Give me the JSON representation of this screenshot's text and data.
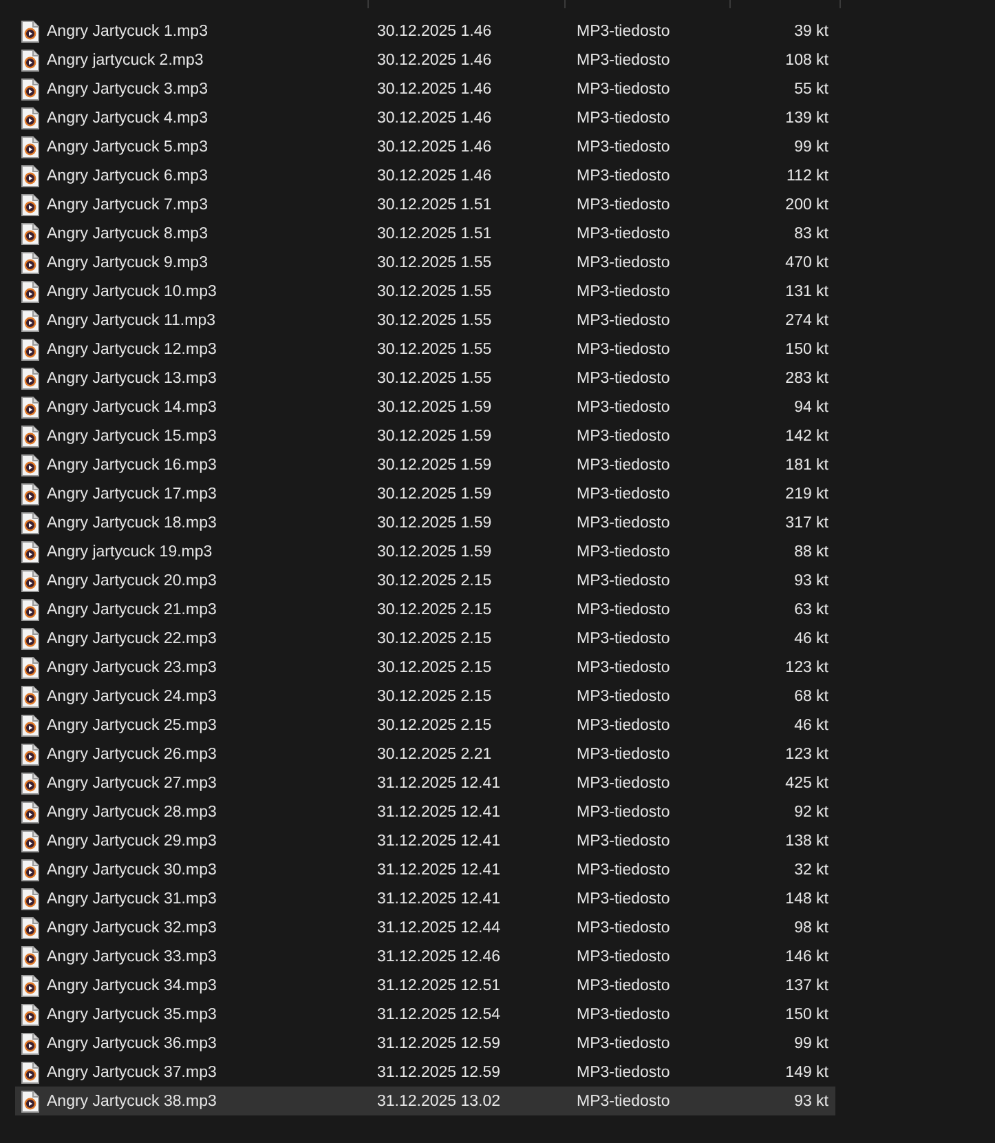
{
  "files": [
    {
      "name": "Angry Jartycuck 1.mp3",
      "date": "30.12.2025 1.46",
      "type": "MP3-tiedosto",
      "size": "39 kt",
      "selected": false
    },
    {
      "name": "Angry jartycuck 2.mp3",
      "date": "30.12.2025 1.46",
      "type": "MP3-tiedosto",
      "size": "108 kt",
      "selected": false
    },
    {
      "name": "Angry Jartycuck 3.mp3",
      "date": "30.12.2025 1.46",
      "type": "MP3-tiedosto",
      "size": "55 kt",
      "selected": false
    },
    {
      "name": "Angry Jartycuck 4.mp3",
      "date": "30.12.2025 1.46",
      "type": "MP3-tiedosto",
      "size": "139 kt",
      "selected": false
    },
    {
      "name": "Angry Jartycuck 5.mp3",
      "date": "30.12.2025 1.46",
      "type": "MP3-tiedosto",
      "size": "99 kt",
      "selected": false
    },
    {
      "name": "Angry Jartycuck 6.mp3",
      "date": "30.12.2025 1.46",
      "type": "MP3-tiedosto",
      "size": "112 kt",
      "selected": false
    },
    {
      "name": "Angry Jartycuck 7.mp3",
      "date": "30.12.2025 1.51",
      "type": "MP3-tiedosto",
      "size": "200 kt",
      "selected": false
    },
    {
      "name": "Angry Jartycuck 8.mp3",
      "date": "30.12.2025 1.51",
      "type": "MP3-tiedosto",
      "size": "83 kt",
      "selected": false
    },
    {
      "name": "Angry Jartycuck 9.mp3",
      "date": "30.12.2025 1.55",
      "type": "MP3-tiedosto",
      "size": "470 kt",
      "selected": false
    },
    {
      "name": "Angry Jartycuck 10.mp3",
      "date": "30.12.2025 1.55",
      "type": "MP3-tiedosto",
      "size": "131 kt",
      "selected": false
    },
    {
      "name": "Angry Jartycuck 11.mp3",
      "date": "30.12.2025 1.55",
      "type": "MP3-tiedosto",
      "size": "274 kt",
      "selected": false
    },
    {
      "name": "Angry Jartycuck 12.mp3",
      "date": "30.12.2025 1.55",
      "type": "MP3-tiedosto",
      "size": "150 kt",
      "selected": false
    },
    {
      "name": "Angry Jartycuck 13.mp3",
      "date": "30.12.2025 1.55",
      "type": "MP3-tiedosto",
      "size": "283 kt",
      "selected": false
    },
    {
      "name": "Angry Jartycuck 14.mp3",
      "date": "30.12.2025 1.59",
      "type": "MP3-tiedosto",
      "size": "94 kt",
      "selected": false
    },
    {
      "name": "Angry Jartycuck 15.mp3",
      "date": "30.12.2025 1.59",
      "type": "MP3-tiedosto",
      "size": "142 kt",
      "selected": false
    },
    {
      "name": "Angry Jartycuck 16.mp3",
      "date": "30.12.2025 1.59",
      "type": "MP3-tiedosto",
      "size": "181 kt",
      "selected": false
    },
    {
      "name": "Angry Jartycuck 17.mp3",
      "date": "30.12.2025 1.59",
      "type": "MP3-tiedosto",
      "size": "219 kt",
      "selected": false
    },
    {
      "name": "Angry Jartycuck 18.mp3",
      "date": "30.12.2025 1.59",
      "type": "MP3-tiedosto",
      "size": "317 kt",
      "selected": false
    },
    {
      "name": "Angry jartycuck 19.mp3",
      "date": "30.12.2025 1.59",
      "type": "MP3-tiedosto",
      "size": "88 kt",
      "selected": false
    },
    {
      "name": "Angry Jartycuck 20.mp3",
      "date": "30.12.2025 2.15",
      "type": "MP3-tiedosto",
      "size": "93 kt",
      "selected": false
    },
    {
      "name": "Angry Jartycuck 21.mp3",
      "date": "30.12.2025 2.15",
      "type": "MP3-tiedosto",
      "size": "63 kt",
      "selected": false
    },
    {
      "name": "Angry Jartycuck 22.mp3",
      "date": "30.12.2025 2.15",
      "type": "MP3-tiedosto",
      "size": "46 kt",
      "selected": false
    },
    {
      "name": "Angry Jartycuck 23.mp3",
      "date": "30.12.2025 2.15",
      "type": "MP3-tiedosto",
      "size": "123 kt",
      "selected": false
    },
    {
      "name": "Angry Jartycuck 24.mp3",
      "date": "30.12.2025 2.15",
      "type": "MP3-tiedosto",
      "size": "68 kt",
      "selected": false
    },
    {
      "name": "Angry Jartycuck 25.mp3",
      "date": "30.12.2025 2.15",
      "type": "MP3-tiedosto",
      "size": "46 kt",
      "selected": false
    },
    {
      "name": "Angry Jartycuck 26.mp3",
      "date": "30.12.2025 2.21",
      "type": "MP3-tiedosto",
      "size": "123 kt",
      "selected": false
    },
    {
      "name": "Angry Jartycuck 27.mp3",
      "date": "31.12.2025 12.41",
      "type": "MP3-tiedosto",
      "size": "425 kt",
      "selected": false
    },
    {
      "name": "Angry Jartycuck 28.mp3",
      "date": "31.12.2025 12.41",
      "type": "MP3-tiedosto",
      "size": "92 kt",
      "selected": false
    },
    {
      "name": "Angry Jartycuck 29.mp3",
      "date": "31.12.2025 12.41",
      "type": "MP3-tiedosto",
      "size": "138 kt",
      "selected": false
    },
    {
      "name": "Angry Jartycuck 30.mp3",
      "date": "31.12.2025 12.41",
      "type": "MP3-tiedosto",
      "size": "32 kt",
      "selected": false
    },
    {
      "name": "Angry Jartycuck 31.mp3",
      "date": "31.12.2025 12.41",
      "type": "MP3-tiedosto",
      "size": "148 kt",
      "selected": false
    },
    {
      "name": "Angry Jartycuck 32.mp3",
      "date": "31.12.2025 12.44",
      "type": "MP3-tiedosto",
      "size": "98 kt",
      "selected": false
    },
    {
      "name": "Angry Jartycuck 33.mp3",
      "date": "31.12.2025 12.46",
      "type": "MP3-tiedosto",
      "size": "146 kt",
      "selected": false
    },
    {
      "name": "Angry Jartycuck 34.mp3",
      "date": "31.12.2025 12.51",
      "type": "MP3-tiedosto",
      "size": "137 kt",
      "selected": false
    },
    {
      "name": "Angry Jartycuck 35.mp3",
      "date": "31.12.2025 12.54",
      "type": "MP3-tiedosto",
      "size": "150 kt",
      "selected": false
    },
    {
      "name": "Angry Jartycuck 36.mp3",
      "date": "31.12.2025 12.59",
      "type": "MP3-tiedosto",
      "size": "99 kt",
      "selected": false
    },
    {
      "name": "Angry Jartycuck 37.mp3",
      "date": "31.12.2025 12.59",
      "type": "MP3-tiedosto",
      "size": "149 kt",
      "selected": false
    },
    {
      "name": "Angry Jartycuck 38.mp3",
      "date": "31.12.2025 13.02",
      "type": "MP3-tiedosto",
      "size": "93 kt",
      "selected": true
    }
  ]
}
